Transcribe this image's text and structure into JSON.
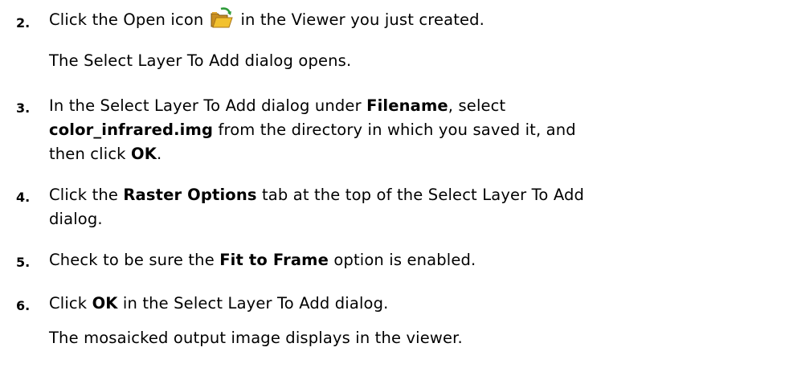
{
  "steps": [
    {
      "number": "2.",
      "before_icon": "Click the Open icon",
      "icon": "open-folder-icon",
      "after_icon": "in the Viewer you just created.",
      "result": "The Select Layer To Add dialog opens."
    },
    {
      "number": "3.",
      "line1_a": "In the Select Layer To Add dialog under ",
      "line1_b": "Filename",
      "line1_c": ", select",
      "line2_a": "color_infrared.img",
      "line2_b": " from the directory in which you saved it, and",
      "line3_a": "then click ",
      "line3_b": "OK",
      "line3_c": "."
    },
    {
      "number": "4.",
      "line1_a": "Click the ",
      "line1_b": "Raster Options",
      "line1_c": " tab at the top of the Select Layer To Add",
      "line2": "dialog."
    },
    {
      "number": "5.",
      "a": "Check to be sure the ",
      "b": "Fit to Frame",
      "c": " option is enabled."
    },
    {
      "number": "6.",
      "a": "Click ",
      "b": "OK",
      "c": " in the Select Layer To Add dialog.",
      "result": "The mosaicked output image displays in the viewer."
    }
  ],
  "colors": {
    "text": "#000000",
    "folder_yellow": "#f2c12e",
    "folder_dark": "#a8741a",
    "arrow_green": "#2e9b3a"
  }
}
